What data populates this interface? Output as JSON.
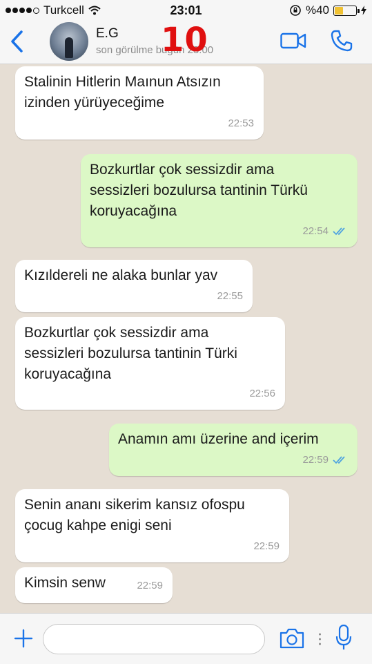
{
  "status_bar": {
    "carrier": "Turkcell",
    "time": "23:01",
    "battery_text": "%40",
    "battery_level": 0.4
  },
  "header": {
    "contact_name": "E.G",
    "last_seen": "son görülme bugün 23:00",
    "overlay_number": "10",
    "icons": [
      "back-chevron-icon",
      "video-call-icon",
      "phone-call-icon"
    ]
  },
  "messages": [
    {
      "direction": "in",
      "text": "Stalinin Hitlerin Mаınun Atsızın\nizinden yürüyeceğime",
      "time": "22:53",
      "read": false
    },
    {
      "direction": "out",
      "text": "Bozkurtlar çok sessizdir ama\nsessizleri bozulursa tantinin Türkü\nkoruyacağına",
      "time": "22:54",
      "read": true
    },
    {
      "direction": "in",
      "text": "Kızıldereli ne alaka bunlar yav",
      "time": "22:55",
      "read": false
    },
    {
      "direction": "in",
      "text": "Bozkurtlar çok sessizdir ama\nsessizleri bozulursa tantinin Türki\nkoruyacağına",
      "time": "22:56",
      "read": false
    },
    {
      "direction": "out",
      "text": "Anamın amı üzerine and içerim",
      "time": "22:59",
      "read": true
    },
    {
      "direction": "in",
      "text": "Senin ananı sikerim kansız ofospu\nçocug kahpe enigi seni",
      "time": "22:59",
      "read": false
    },
    {
      "direction": "in",
      "text": "Kimsin senw",
      "time": "22:59",
      "read": false
    }
  ],
  "input_bar": {
    "placeholder": "",
    "value": ""
  },
  "colors": {
    "accent": "#1a73e8",
    "incoming_bubble": "#ffffff",
    "outgoing_bubble": "#dcf8c6",
    "read_tick": "#4fa3e0",
    "overlay_number": "#e01010"
  }
}
